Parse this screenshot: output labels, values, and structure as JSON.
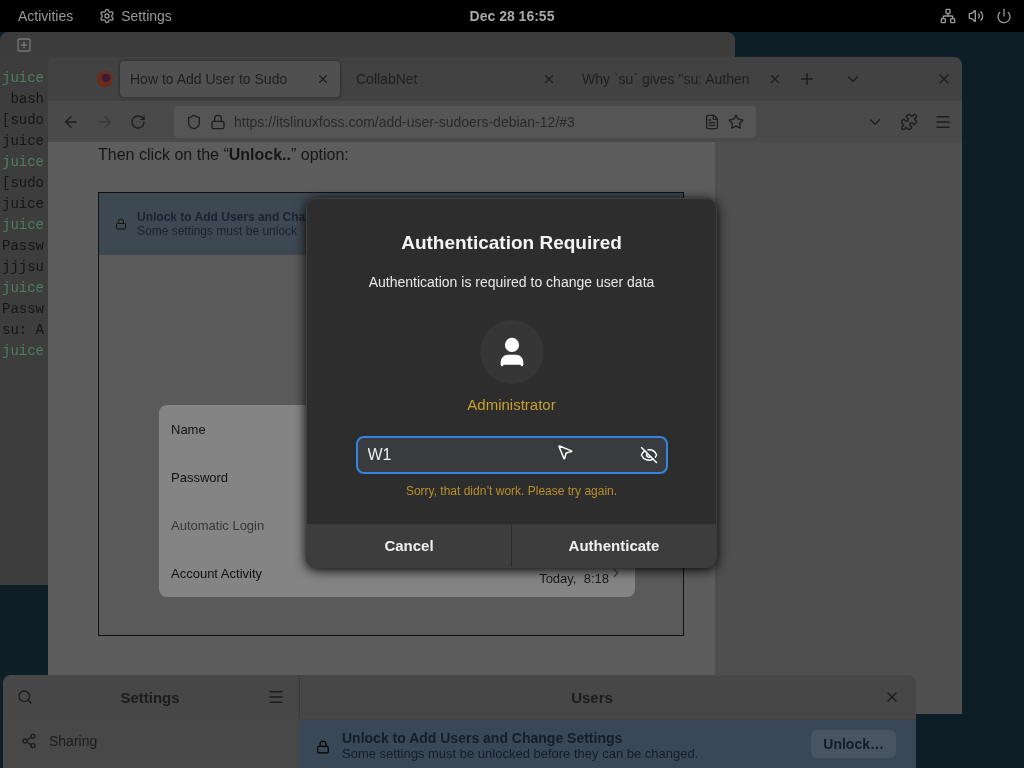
{
  "top_bar": {
    "activities": "Activities",
    "app_menu": "Settings",
    "clock": "Dec 28  16:55"
  },
  "terminal": {
    "lines": [
      {
        "text": "juice",
        "kind": "prompt"
      },
      {
        "text": " bash",
        "kind": "output"
      },
      {
        "text": "[sudo",
        "kind": "output"
      },
      {
        "text": "juice",
        "kind": "output"
      },
      {
        "text": "juice",
        "kind": "prompt"
      },
      {
        "text": "[sudo",
        "kind": "output"
      },
      {
        "text": "juice",
        "kind": "output"
      },
      {
        "text": "juice",
        "kind": "prompt"
      },
      {
        "text": "Passw",
        "kind": "output"
      },
      {
        "text": "jjjsu",
        "kind": "output"
      },
      {
        "text": "juice",
        "kind": "prompt"
      },
      {
        "text": "Passw",
        "kind": "output"
      },
      {
        "text": "su: A",
        "kind": "output"
      },
      {
        "text": "juice",
        "kind": "prompt"
      }
    ]
  },
  "browser": {
    "tabs": [
      {
        "label": "How to Add User to Sudo",
        "selected": true
      },
      {
        "label": "CollabNet",
        "selected": false
      },
      {
        "label": "Why `su` gives \"su: Authen",
        "selected": false
      }
    ],
    "url": "https://itslinuxfoss.com/add-user-sudoers-debian-12/#3",
    "article": {
      "paragraphs": [
        "Then click on the “**Unlock..**” option:"
      ],
      "figure": {
        "banner_title": "Unlock to Add Users and Cha",
        "banner_subtitle": "Some settings must be unlock",
        "rows": [
          {
            "label": "Name",
            "disabled": false
          },
          {
            "label": "Password",
            "disabled": false
          },
          {
            "label": "Automatic Login",
            "disabled": true
          },
          {
            "label": "Account Activity",
            "disabled": false,
            "value": "Today,  8:18"
          }
        ]
      }
    }
  },
  "settings": {
    "sidebar_title": "Settings",
    "sidebar_items": [
      {
        "label": "Sharing"
      }
    ],
    "page_title": "Users",
    "banner_title": "Unlock to Add Users and Change Settings",
    "banner_subtitle": "Some settings must be unlocked before they can be changed.",
    "unlock_button": "Unlock…"
  },
  "dialog": {
    "title": "Authentication Required",
    "message": "Authentication is required to change user data",
    "user": "Administrator",
    "password": {
      "value": "W1",
      "focused": true
    },
    "error": "Sorry, that didn’t work. Please try again.",
    "buttons": [
      "Cancel",
      "Authenticate"
    ]
  }
}
